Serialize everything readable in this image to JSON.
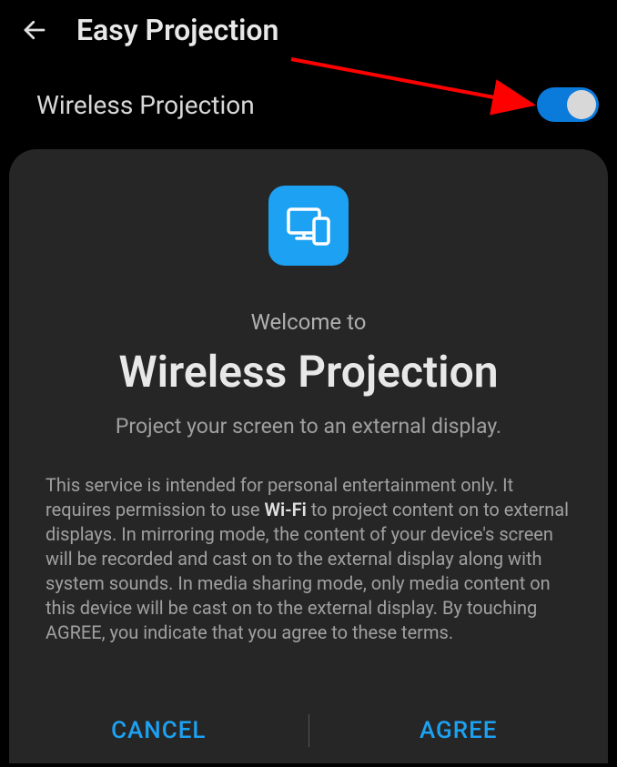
{
  "header": {
    "title": "Easy Projection"
  },
  "toggle": {
    "label": "Wireless Projection",
    "state": true
  },
  "dialog": {
    "welcome": "Welcome to",
    "title": "Wireless Projection",
    "subtitle": "Project your screen to an external display.",
    "body_pre": "This service is intended for personal entertainment only. It requires permission to use ",
    "body_bold": "Wi-Fi",
    "body_post": " to project content on to external displays. In mirroring mode, the content of your device's screen will be recorded and cast on to the external display along with system sounds. In media sharing mode, only media content on this device will be cast on to the external display. By touching AGREE, you indicate that you agree to these terms.",
    "cancel_label": "CANCEL",
    "agree_label": "AGREE"
  },
  "colors": {
    "accent": "#1da1f2",
    "toggle": "#0a7adb",
    "annotation": "#ff0000"
  }
}
